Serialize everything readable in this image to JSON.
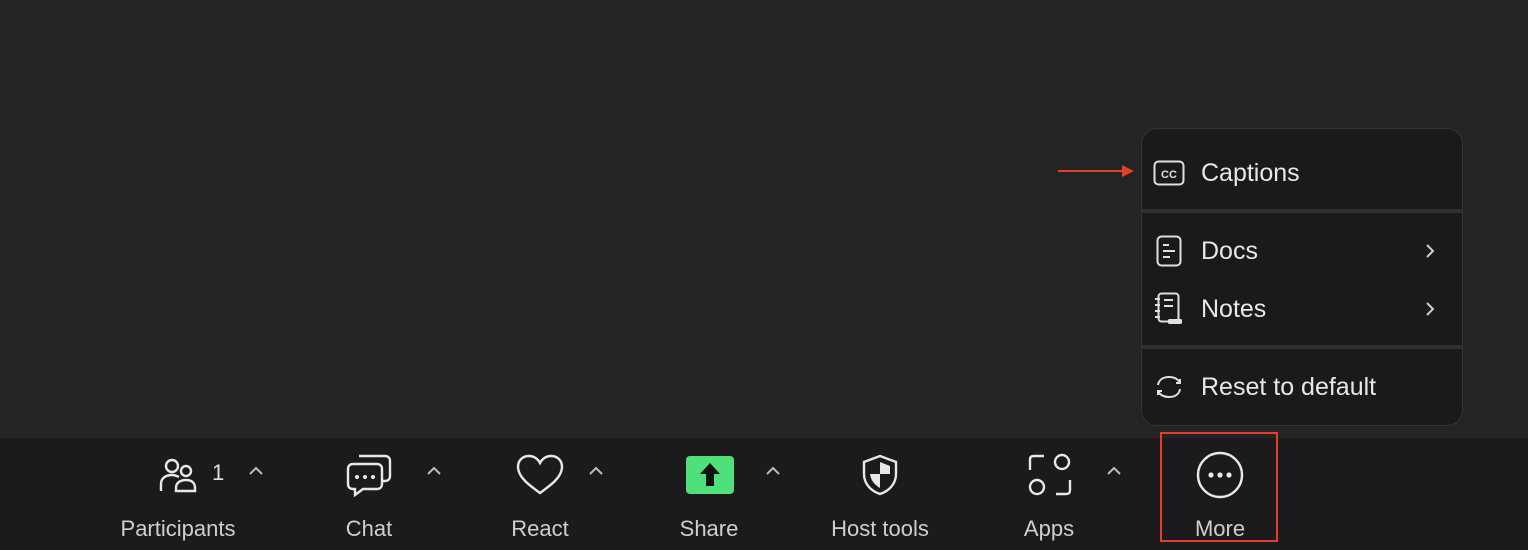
{
  "menu": {
    "items": [
      {
        "label": "Captions",
        "icon": "closed-captions-icon",
        "has_submenu": false
      },
      {
        "label": "Docs",
        "icon": "document-icon",
        "has_submenu": true
      },
      {
        "label": "Notes",
        "icon": "notes-icon",
        "has_submenu": true
      },
      {
        "label": "Reset to default",
        "icon": "reset-icon",
        "has_submenu": false
      }
    ]
  },
  "toolbar": {
    "participants": {
      "label": "Participants",
      "count": "1",
      "icon": "participants-icon"
    },
    "chat": {
      "label": "Chat",
      "icon": "chat-icon"
    },
    "react": {
      "label": "React",
      "icon": "heart-icon"
    },
    "share": {
      "label": "Share",
      "icon": "share-screen-icon",
      "accent": "#4ee07a"
    },
    "host_tools": {
      "label": "Host tools",
      "icon": "shield-icon"
    },
    "apps": {
      "label": "Apps",
      "icon": "apps-icon"
    },
    "more": {
      "label": "More",
      "icon": "more-icon"
    }
  },
  "colors": {
    "annotation": "#e2402c",
    "share_accent": "#4ee07a",
    "background": "#242424",
    "toolbar": "#1b1b1d"
  }
}
